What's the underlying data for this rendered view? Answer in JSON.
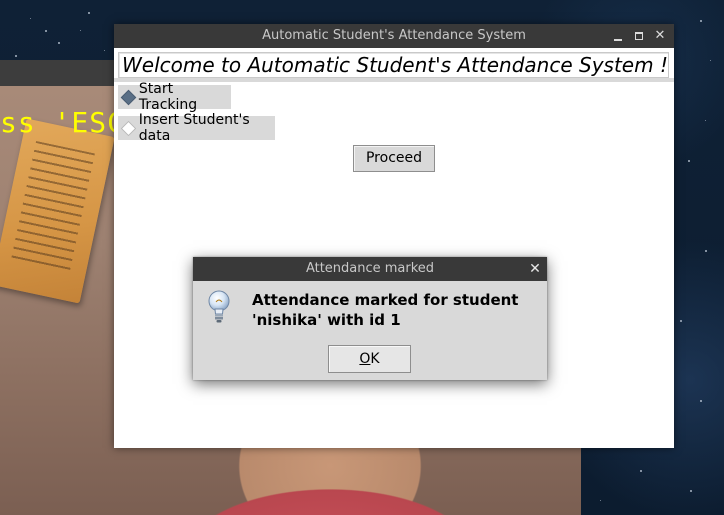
{
  "main_window": {
    "title": "Automatic Student's Attendance System",
    "controls": {
      "minimize_icon": "minimize-icon",
      "maximize_icon": "maximize-icon",
      "close_icon": "close-icon",
      "close_glyph": "✕"
    },
    "welcome_text": "Welcome to Automatic Student's Attendance System !",
    "options": [
      {
        "label": "Start Tracking",
        "selected": true
      },
      {
        "label": "Insert Student's data",
        "selected": false
      }
    ],
    "proceed_label": "Proceed"
  },
  "dialog": {
    "title": "Attendance marked",
    "close_glyph": "✕",
    "icon": "info-bulb-icon",
    "message": "Attendance marked for student 'nishika' with id 1",
    "ok_label_first": "O",
    "ok_label_rest": "K"
  },
  "webcam": {
    "overlay_text": "ss 'ESC"
  },
  "colors": {
    "titlebar": "#393939",
    "title_text": "#c8c8c8",
    "widget_bg": "#d9d9d9",
    "overlay_text": "#ffff00",
    "radio_selected": "#5a6f86"
  }
}
